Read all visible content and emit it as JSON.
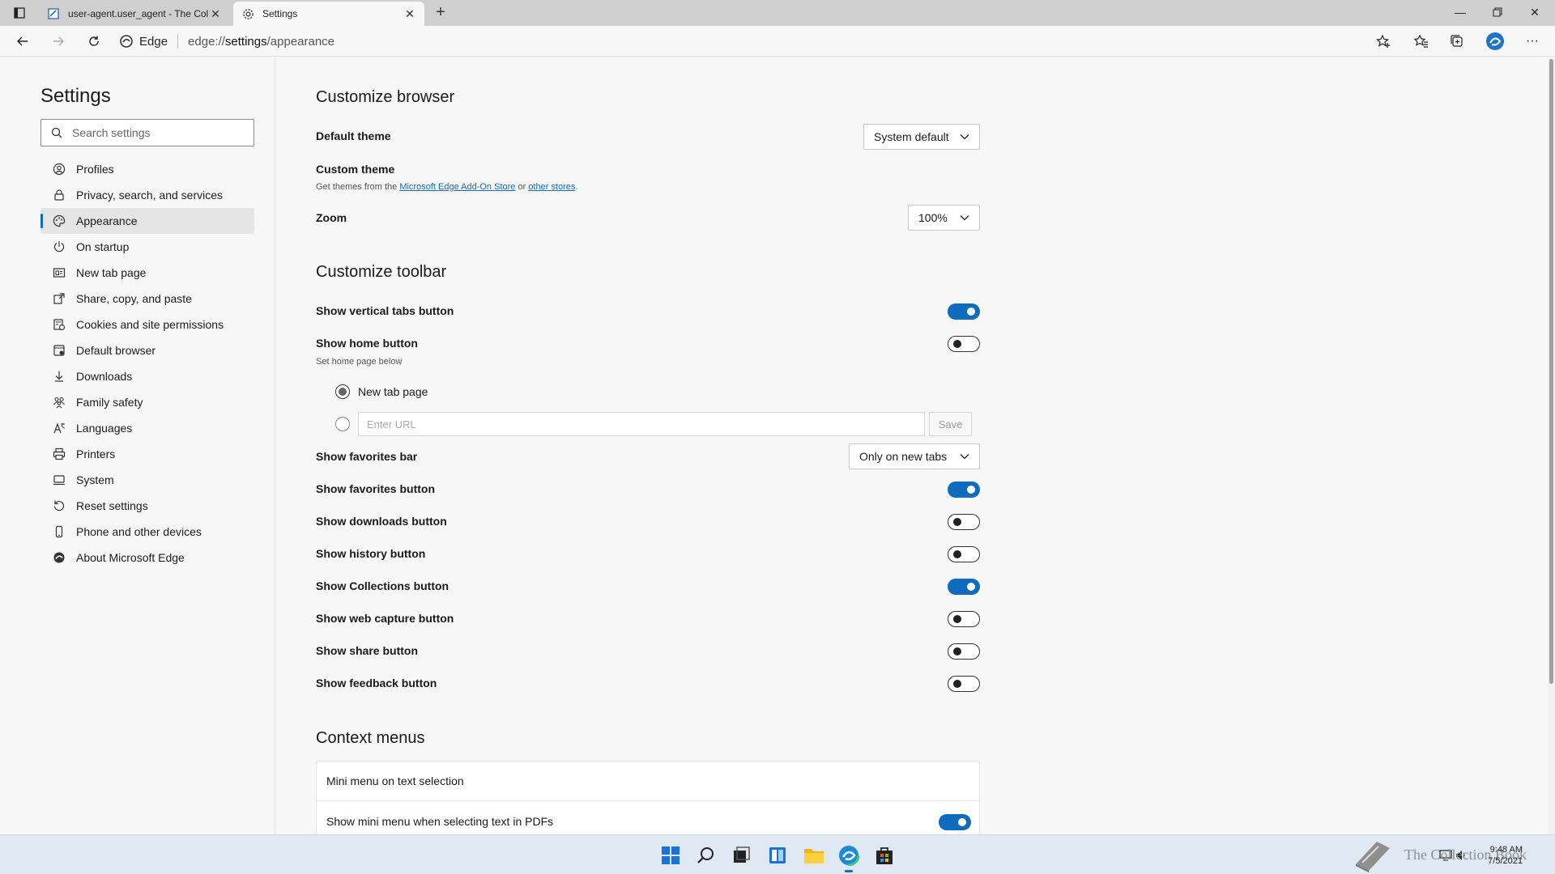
{
  "browser": {
    "tabs": [
      {
        "title": "user-agent.user_agent - The Coll",
        "active": false
      },
      {
        "title": "Settings",
        "active": true
      }
    ],
    "address": {
      "brand": "Edge",
      "url_prefix": "edge://",
      "url_main": "settings",
      "url_suffix": "/appearance"
    }
  },
  "sidebar": {
    "title": "Settings",
    "search_placeholder": "Search settings",
    "items": [
      {
        "label": "Profiles",
        "icon": "profile-icon"
      },
      {
        "label": "Privacy, search, and services",
        "icon": "lock-icon"
      },
      {
        "label": "Appearance",
        "icon": "palette-icon",
        "active": true
      },
      {
        "label": "On startup",
        "icon": "power-icon"
      },
      {
        "label": "New tab page",
        "icon": "newtab-icon"
      },
      {
        "label": "Share, copy, and paste",
        "icon": "share-icon"
      },
      {
        "label": "Cookies and site permissions",
        "icon": "cookie-icon"
      },
      {
        "label": "Default browser",
        "icon": "browser-icon"
      },
      {
        "label": "Downloads",
        "icon": "download-icon"
      },
      {
        "label": "Family safety",
        "icon": "family-icon"
      },
      {
        "label": "Languages",
        "icon": "language-icon"
      },
      {
        "label": "Printers",
        "icon": "printer-icon"
      },
      {
        "label": "System",
        "icon": "system-icon"
      },
      {
        "label": "Reset settings",
        "icon": "reset-icon"
      },
      {
        "label": "Phone and other devices",
        "icon": "phone-icon"
      },
      {
        "label": "About Microsoft Edge",
        "icon": "edge-icon"
      }
    ]
  },
  "main": {
    "customize_browser": {
      "title": "Customize browser",
      "default_theme_label": "Default theme",
      "default_theme_value": "System default",
      "custom_theme_label": "Custom theme",
      "custom_theme_sub_prefix": "Get themes from the ",
      "custom_theme_link1": "Microsoft Edge Add-On Store",
      "custom_theme_sub_mid": " or ",
      "custom_theme_link2": "other stores",
      "custom_theme_sub_suffix": ".",
      "zoom_label": "Zoom",
      "zoom_value": "100%"
    },
    "customize_toolbar": {
      "title": "Customize toolbar",
      "vertical_tabs": {
        "label": "Show vertical tabs button",
        "on": true
      },
      "home": {
        "label": "Show home button",
        "on": false,
        "sub": "Set home page below"
      },
      "home_radio_newtab": "New tab page",
      "home_url_placeholder": "Enter URL",
      "home_save": "Save",
      "favorites_bar": {
        "label": "Show favorites bar",
        "value": "Only on new tabs"
      },
      "favorites_button": {
        "label": "Show favorites button",
        "on": true
      },
      "downloads_button": {
        "label": "Show downloads button",
        "on": false
      },
      "history_button": {
        "label": "Show history button",
        "on": false
      },
      "collections_button": {
        "label": "Show Collections button",
        "on": true
      },
      "web_capture_button": {
        "label": "Show web capture button",
        "on": false
      },
      "share_button": {
        "label": "Show share button",
        "on": false
      },
      "feedback_button": {
        "label": "Show feedback button",
        "on": false
      }
    },
    "context_menus": {
      "title": "Context menus",
      "mini_menu_label": "Mini menu on text selection",
      "mini_menu_pdf": {
        "label": "Show mini menu when selecting text in PDFs",
        "on": true
      }
    }
  },
  "taskbar": {
    "watermark": "The Collection Book",
    "time": "9:48 AM",
    "date": "7/5/2021"
  },
  "colors": {
    "accent": "#0f6cbd",
    "taskbar": "#dfe8f3"
  }
}
